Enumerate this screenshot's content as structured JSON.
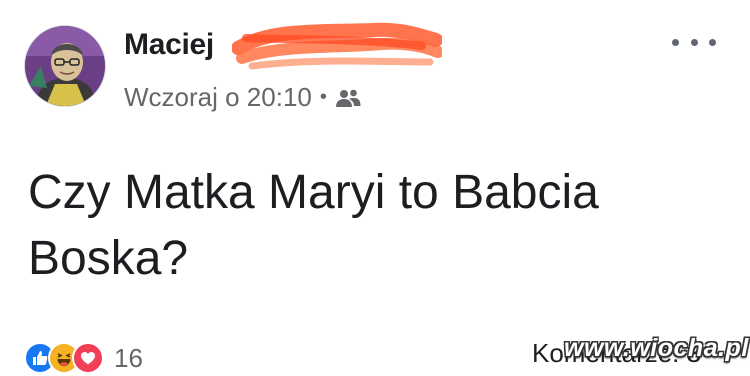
{
  "post": {
    "author": "Maciej",
    "timestamp": "Wczoraj o 20:10",
    "separator": "•",
    "audience_icon": "friends-icon",
    "menu_icon": "more-options-icon",
    "text": "Czy Matka Maryi to Babcia Boska?",
    "reactions": {
      "icons": [
        "like-reaction-icon",
        "haha-reaction-icon",
        "love-reaction-icon"
      ],
      "count": "16"
    },
    "comments_label": "Komentarze: 3"
  },
  "watermark": "www.wiocha.pl",
  "colors": {
    "like": "#1877f2",
    "haha": "#f7b125",
    "love": "#f33e58",
    "redaction": "#ff5a2e",
    "secondary_text": "#65676b"
  }
}
